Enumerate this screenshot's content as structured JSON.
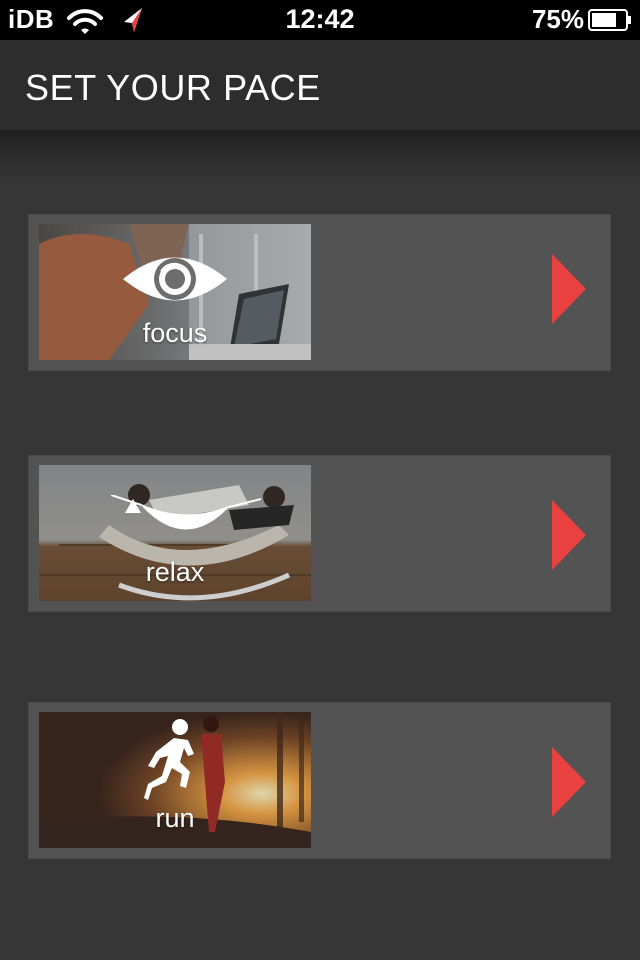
{
  "status_bar": {
    "carrier": "iDB",
    "time": "12:42",
    "battery": "75%",
    "icons": [
      "wifi-icon",
      "location-arrow-icon",
      "battery-icon"
    ]
  },
  "header": {
    "title": "SET YOUR PACE"
  },
  "options": [
    {
      "label": "focus",
      "icon": "eye-icon",
      "photo": "people-at-laptop"
    },
    {
      "label": "relax",
      "icon": "hammock-icon",
      "photo": "couple-in-rocking-chair"
    },
    {
      "label": "run",
      "icon": "runner-icon",
      "photo": "runner-at-sunrise"
    }
  ],
  "colors": {
    "accent": "#e94040",
    "background": "#363636",
    "card": "#535353",
    "header": "#2d2d2d"
  }
}
